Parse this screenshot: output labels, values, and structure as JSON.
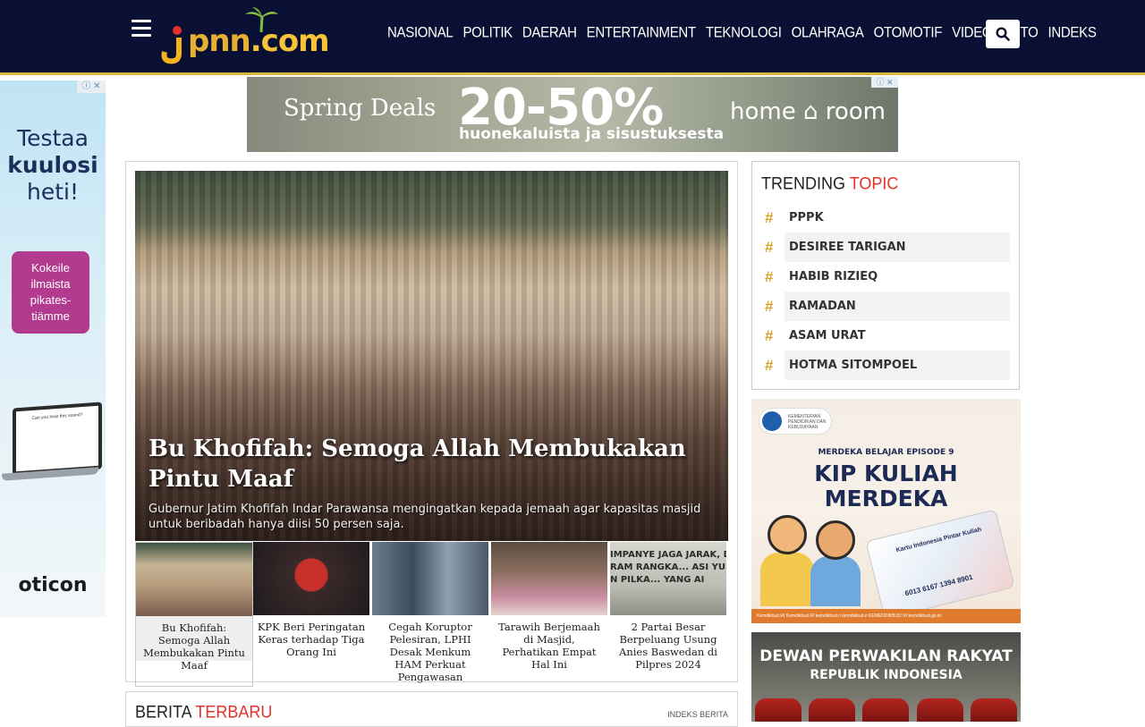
{
  "site": {
    "logo_text_j": "j",
    "logo_text_pnn": "pnn",
    "logo_text_com": ".com"
  },
  "nav": {
    "items": [
      "NASIONAL",
      "POLITIK",
      "DAERAH",
      "ENTERTAINMENT",
      "TEKNOLOGI",
      "OLAHRAGA",
      "OTOMOTIF",
      "VIDEO",
      "FOTO",
      "INDEKS"
    ]
  },
  "side_ad": {
    "line1": "Testaa",
    "line2": "kuulosi",
    "line3": "heti!",
    "cta": "Kokeile ilmaista pikates-tiämme",
    "laptop_text": "Can you hear this sound?",
    "brand": "oticon"
  },
  "top_ad": {
    "left": "Spring Deals",
    "big": "20-50%",
    "sub": "huonekaluista ja sisustuksesta",
    "brand": "home ⌂ room"
  },
  "hero": {
    "title": "Bu Khofifah: Semoga Allah Membukakan Pintu Maaf",
    "desc": "Gubernur Jatim Khofifah Indar Parawansa mengingatkan kepada jemaah agar kapasitas masjid untuk beribadah hanya diisi 50 persen saja."
  },
  "thumbs": [
    {
      "caption": "Bu Khofifah: Semoga Allah Membukakan Pintu Maaf",
      "color": "#a89272"
    },
    {
      "caption": "KPK Beri Peringatan Keras terhadap Tiga Orang Ini",
      "color": "#3b2a2a"
    },
    {
      "caption": "Cegah Koruptor Pelesiran, LPHI Desak Menkum HAM Perkuat Pengawasan",
      "color": "#5c6f7e"
    },
    {
      "caption": "Tarawih Berjemaah di Masjid, Perhatikan Empat Hal Ini",
      "color": "#6f5a4c"
    },
    {
      "caption": "2 Partai Besar Berpeluang Usung Anies Baswedan di Pilpres 2024",
      "color": "#c9c9c2"
    }
  ],
  "thumb5_overlay": "IMPANYE JAGA JARAK, DA\nRAM RANGKA... ASI YUST\nN PILKA... YANG AI",
  "latest": {
    "title_a": "BERITA ",
    "title_b": "TERBARU",
    "link": "INDEKS BERITA"
  },
  "trending": {
    "title_a": "TRENDING ",
    "title_b": "TOPIC",
    "items": [
      "PPPK",
      "DESIREE TARIGAN",
      "HABIB RIZIEQ",
      "RAMADAN",
      "ASAM URAT",
      "HOTMA SITOMPOEL"
    ]
  },
  "kip_ad": {
    "ministry": "KEMENTERIAN PENDIDIKAN DAN KEBUDAYAAN",
    "episode": "MERDEKA BELAJAR EPISODE 9",
    "title1": "KIP KULIAH",
    "title2": "MERDEKA",
    "card_title": "Kartu Indonesia Pintar Kuliah",
    "card_number": "6013 6167 1394 8901",
    "footer": "Kemdikbud.RI   Kemdikbud.RI   kemdikbud.ri   kemdikbud.ri   KEMENDIKBUD RI   kemdikbud.go.id"
  },
  "dpr_ad": {
    "line1": "DEWAN PERWAKILAN RAKYAT",
    "line2": "REPUBLIK INDONESIA"
  }
}
